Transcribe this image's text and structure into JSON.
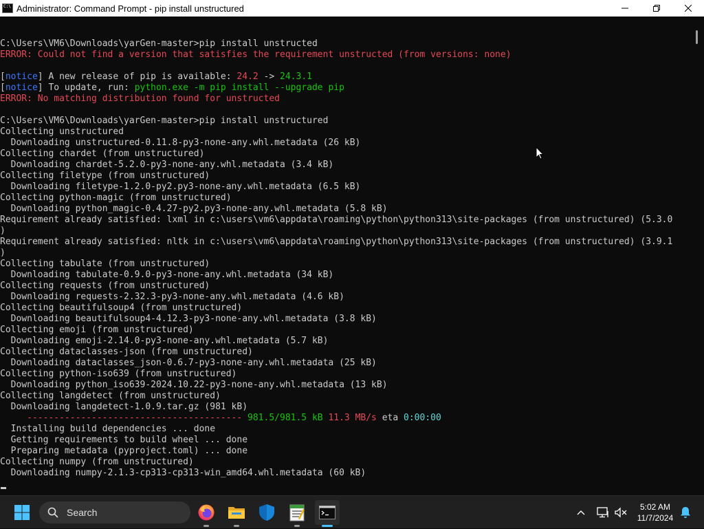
{
  "window": {
    "title": "Administrator: Command Prompt - pip  install unstructured",
    "icon_text": "C:\\"
  },
  "console": {
    "lines": [
      [
        {
          "t": "C:\\Users\\VM6\\Downloads\\yarGen-master>pip install unstructed"
        }
      ],
      [
        {
          "t": "ERROR: Could not find a version that satisfies the requirement unstructed (from versions: none)",
          "c": "red"
        }
      ],
      [
        {
          "t": ""
        }
      ],
      [
        {
          "t": "["
        },
        {
          "t": "notice",
          "c": "blue"
        },
        {
          "t": "] A new release of pip is available: "
        },
        {
          "t": "24.2",
          "c": "red"
        },
        {
          "t": " -> "
        },
        {
          "t": "24.3.1",
          "c": "green"
        }
      ],
      [
        {
          "t": "["
        },
        {
          "t": "notice",
          "c": "blue"
        },
        {
          "t": "] To update, run: "
        },
        {
          "t": "python.exe -m pip install --upgrade pip",
          "c": "green"
        }
      ],
      [
        {
          "t": "ERROR: No matching distribution found for unstructed",
          "c": "red"
        }
      ],
      [
        {
          "t": ""
        }
      ],
      [
        {
          "t": "C:\\Users\\VM6\\Downloads\\yarGen-master>pip install unstructured"
        }
      ],
      [
        {
          "t": "Collecting unstructured"
        }
      ],
      [
        {
          "t": "  Downloading unstructured-0.11.8-py3-none-any.whl.metadata (26 kB)"
        }
      ],
      [
        {
          "t": "Collecting chardet (from unstructured)"
        }
      ],
      [
        {
          "t": "  Downloading chardet-5.2.0-py3-none-any.whl.metadata (3.4 kB)"
        }
      ],
      [
        {
          "t": "Collecting filetype (from unstructured)"
        }
      ],
      [
        {
          "t": "  Downloading filetype-1.2.0-py2.py3-none-any.whl.metadata (6.5 kB)"
        }
      ],
      [
        {
          "t": "Collecting python-magic (from unstructured)"
        }
      ],
      [
        {
          "t": "  Downloading python_magic-0.4.27-py2.py3-none-any.whl.metadata (5.8 kB)"
        }
      ],
      [
        {
          "t": "Requirement already satisfied: lxml in c:\\users\\vm6\\appdata\\roaming\\python\\python313\\site-packages (from unstructured) (5.3.0"
        }
      ],
      [
        {
          "t": ")"
        }
      ],
      [
        {
          "t": "Requirement already satisfied: nltk in c:\\users\\vm6\\appdata\\roaming\\python\\python313\\site-packages (from unstructured) (3.9.1"
        }
      ],
      [
        {
          "t": ")"
        }
      ],
      [
        {
          "t": "Collecting tabulate (from unstructured)"
        }
      ],
      [
        {
          "t": "  Downloading tabulate-0.9.0-py3-none-any.whl.metadata (34 kB)"
        }
      ],
      [
        {
          "t": "Collecting requests (from unstructured)"
        }
      ],
      [
        {
          "t": "  Downloading requests-2.32.3-py3-none-any.whl.metadata (4.6 kB)"
        }
      ],
      [
        {
          "t": "Collecting beautifulsoup4 (from unstructured)"
        }
      ],
      [
        {
          "t": "  Downloading beautifulsoup4-4.12.3-py3-none-any.whl.metadata (3.8 kB)"
        }
      ],
      [
        {
          "t": "Collecting emoji (from unstructured)"
        }
      ],
      [
        {
          "t": "  Downloading emoji-2.14.0-py3-none-any.whl.metadata (5.7 kB)"
        }
      ],
      [
        {
          "t": "Collecting dataclasses-json (from unstructured)"
        }
      ],
      [
        {
          "t": "  Downloading dataclasses_json-0.6.7-py3-none-any.whl.metadata (25 kB)"
        }
      ],
      [
        {
          "t": "Collecting python-iso639 (from unstructured)"
        }
      ],
      [
        {
          "t": "  Downloading python_iso639-2024.10.22-py3-none-any.whl.metadata (13 kB)"
        }
      ],
      [
        {
          "t": "Collecting langdetect (from unstructured)"
        }
      ],
      [
        {
          "t": "  Downloading langdetect-1.0.9.tar.gz (981 kB)"
        }
      ],
      [
        {
          "t": "     ---------------------------------------- ",
          "c": "pipred"
        },
        {
          "t": "981.5/981.5 kB",
          "c": "green"
        },
        {
          "t": " "
        },
        {
          "t": "11.3 MB/s",
          "c": "red"
        },
        {
          "t": " eta "
        },
        {
          "t": "0:00:00",
          "c": "cyan"
        }
      ],
      [
        {
          "t": "  Installing build dependencies ... done"
        }
      ],
      [
        {
          "t": "  Getting requirements to build wheel ... done"
        }
      ],
      [
        {
          "t": "  Preparing metadata (pyproject.toml) ... done"
        }
      ],
      [
        {
          "t": "Collecting numpy (from unstructured)"
        }
      ],
      [
        {
          "t": "  Downloading numpy-2.1.3-cp313-cp313-win_amd64.whl.metadata (60 kB)"
        }
      ]
    ]
  },
  "taskbar": {
    "search_placeholder": "Search",
    "clock_time": "5:02 AM",
    "clock_date": "11/7/2024"
  },
  "colors": {
    "red": "#e74856",
    "blue": "#3b78ff",
    "green": "#16c60c",
    "cyan": "#61d6d6",
    "console_bg": "#0c0c0c",
    "console_fg": "#cccccc",
    "accent": "#4cc2ff"
  },
  "icons": {
    "start": "windows-logo-icon",
    "search": "search-icon",
    "firefox": "firefox-icon",
    "explorer": "folder-icon",
    "defender": "shield-icon",
    "notepad": "notepad-icon",
    "terminal": "command-prompt-icon"
  }
}
